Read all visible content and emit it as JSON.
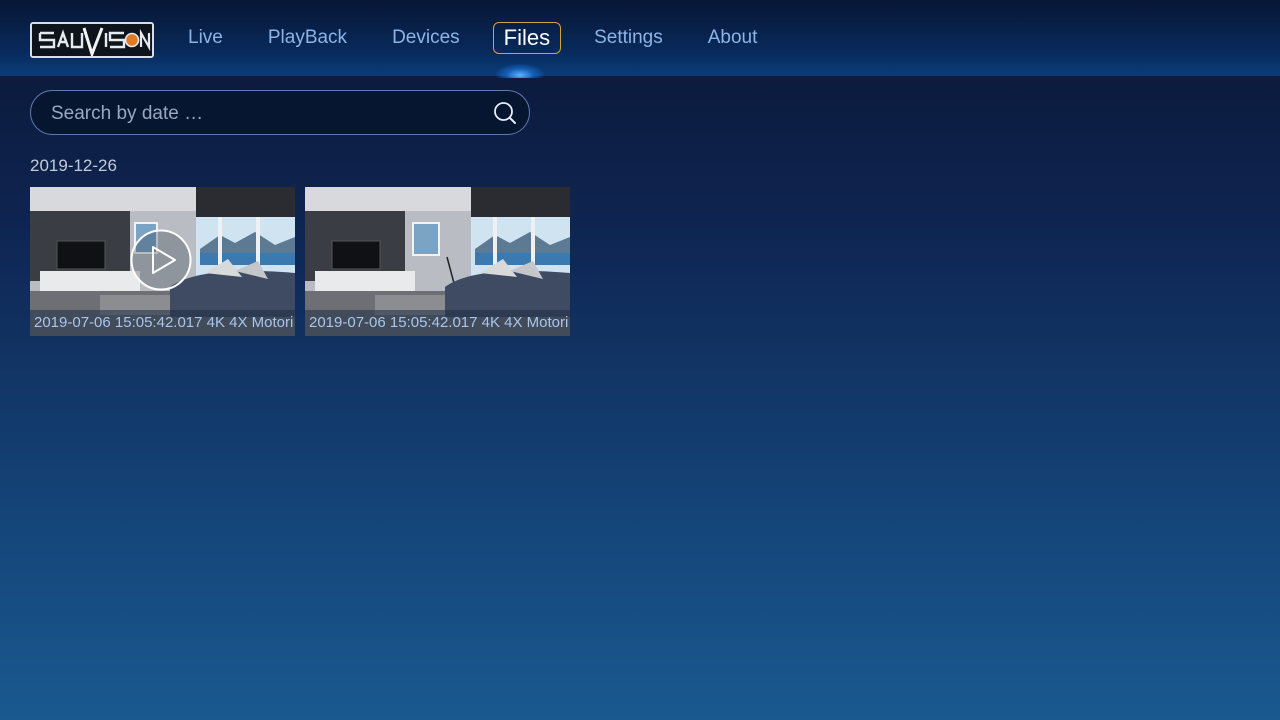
{
  "app": {
    "brand": "SAUVISION"
  },
  "nav": {
    "items": [
      {
        "label": "Live"
      },
      {
        "label": "PlayBack"
      },
      {
        "label": "Devices"
      },
      {
        "label": "Files",
        "active": true
      },
      {
        "label": "Settings"
      },
      {
        "label": "About"
      }
    ]
  },
  "search": {
    "placeholder": "Search by date …",
    "value": ""
  },
  "files": {
    "groups": [
      {
        "date": "2019-12-26",
        "items": [
          {
            "caption": "2019-07-06 15:05:42.017 4K 4X Motori",
            "playing_overlay": true
          },
          {
            "caption": "2019-07-06 15:05:42.017 4K 4X Motori",
            "playing_overlay": false
          }
        ]
      }
    ]
  },
  "colors": {
    "accent_border": "#d4a33a",
    "nav_text": "#8db4e6",
    "caption_text": "#a9c5ec"
  },
  "icons": {
    "search": "search-icon",
    "play": "play-icon",
    "logo": "brand-logo-icon"
  }
}
